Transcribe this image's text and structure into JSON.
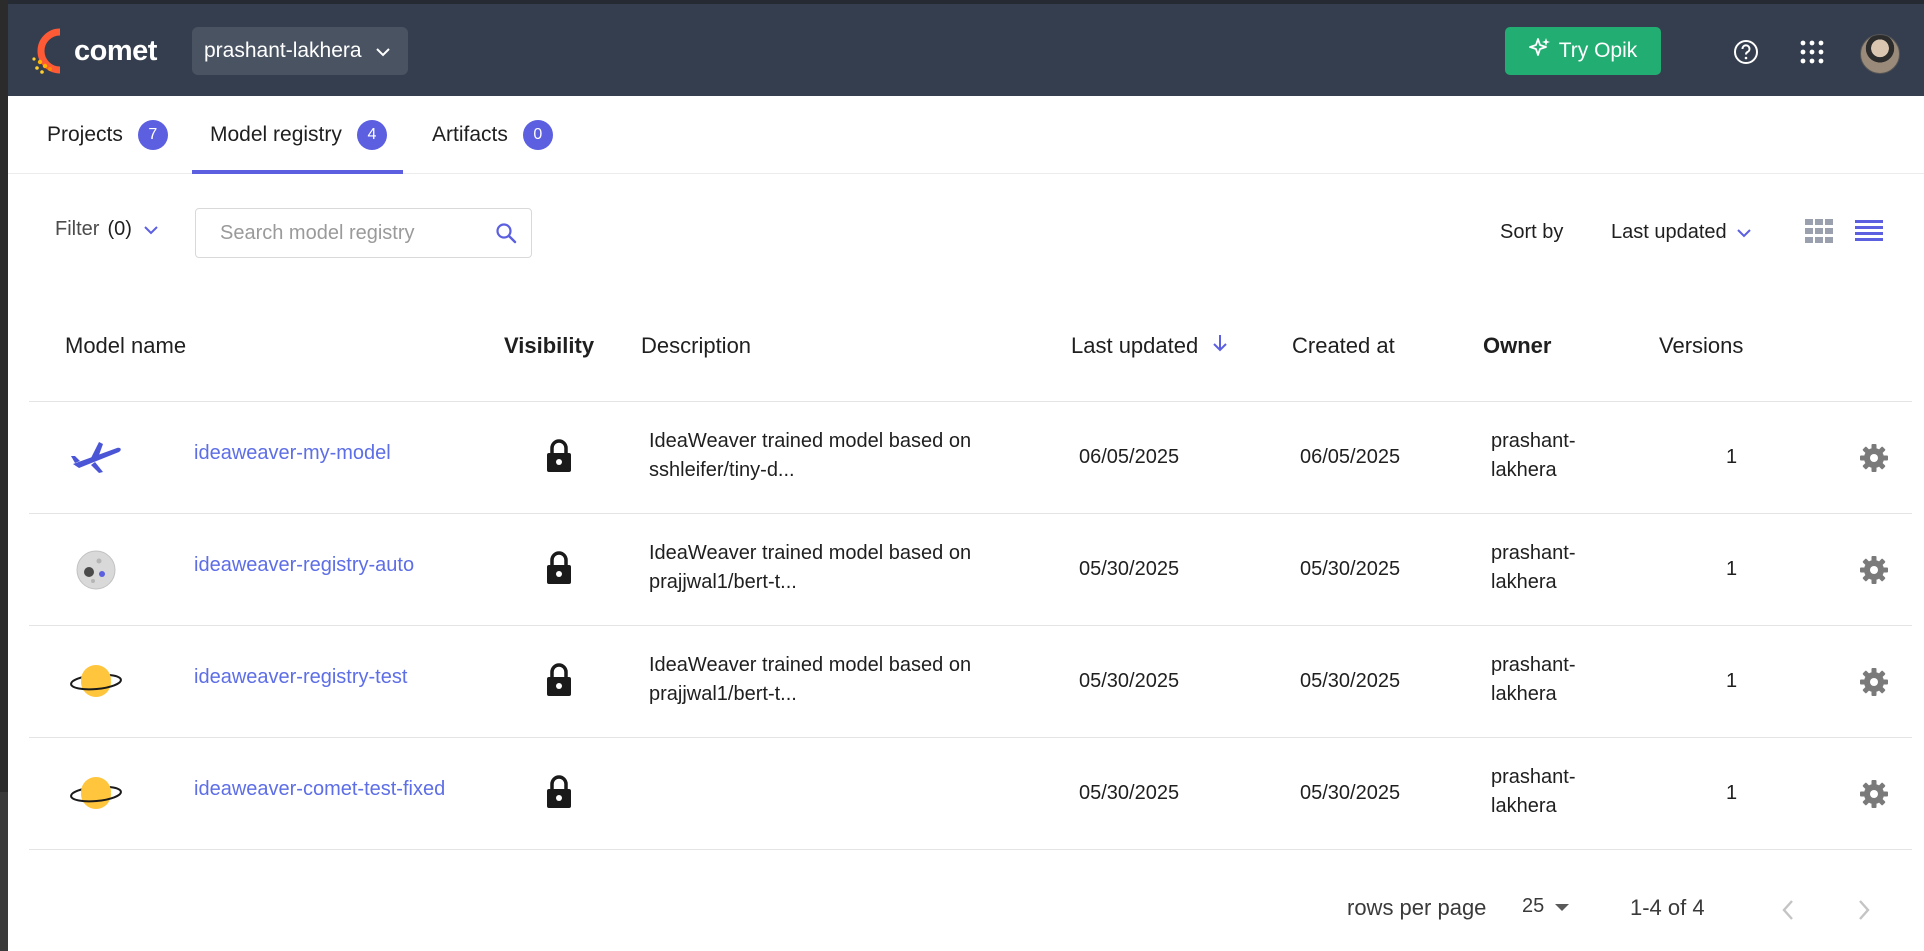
{
  "header": {
    "logo_text": "comet",
    "workspace": "prashant-lakhera",
    "try_button": "Try Opik",
    "icons": [
      "help-icon",
      "apps-grid-icon",
      "avatar"
    ]
  },
  "tabs": [
    {
      "label": "Projects",
      "count": "7",
      "active": false
    },
    {
      "label": "Model registry",
      "count": "4",
      "active": true
    },
    {
      "label": "Artifacts",
      "count": "0",
      "active": false
    }
  ],
  "toolbar": {
    "filter_label": "Filter",
    "filter_count": "(0)",
    "search_placeholder": "Search model registry",
    "sort_label": "Sort by",
    "sort_value": "Last updated"
  },
  "table": {
    "columns": [
      "Model name",
      "Visibility",
      "Description",
      "Last updated",
      "Created at",
      "Owner",
      "Versions"
    ],
    "rows": [
      {
        "icon": "airplane-icon",
        "name": "ideaweaver-my-model",
        "visibility": "private",
        "description_line1": "IdeaWeaver trained model based on",
        "description_line2": "sshleifer/tiny-d...",
        "last_updated": "06/05/2025",
        "created_at": "06/05/2025",
        "owner_line1": "prashant-",
        "owner_line2": "lakhera",
        "versions": "1"
      },
      {
        "icon": "moon-icon",
        "name": "ideaweaver-registry-auto",
        "visibility": "private",
        "description_line1": "IdeaWeaver trained model based on",
        "description_line2": "prajjwal1/bert-t...",
        "last_updated": "05/30/2025",
        "created_at": "05/30/2025",
        "owner_line1": "prashant-",
        "owner_line2": "lakhera",
        "versions": "1"
      },
      {
        "icon": "planet-icon",
        "name": "ideaweaver-registry-test",
        "visibility": "private",
        "description_line1": "IdeaWeaver trained model based on",
        "description_line2": "prajjwal1/bert-t...",
        "last_updated": "05/30/2025",
        "created_at": "05/30/2025",
        "owner_line1": "prashant-",
        "owner_line2": "lakhera",
        "versions": "1"
      },
      {
        "icon": "planet-icon",
        "name": "ideaweaver-comet-test-fixed",
        "visibility": "private",
        "description_line1": "",
        "description_line2": "",
        "last_updated": "05/30/2025",
        "created_at": "05/30/2025",
        "owner_line1": "prashant-",
        "owner_line2": "lakhera",
        "versions": "1"
      }
    ]
  },
  "pagination": {
    "rows_label": "rows per page",
    "rows_value": "25",
    "range": "1-4 of 4"
  },
  "colors": {
    "navbar": "#353e4e",
    "accent": "#5b5fe0",
    "link": "#5d6ee6",
    "try_button": "#22ad72"
  }
}
